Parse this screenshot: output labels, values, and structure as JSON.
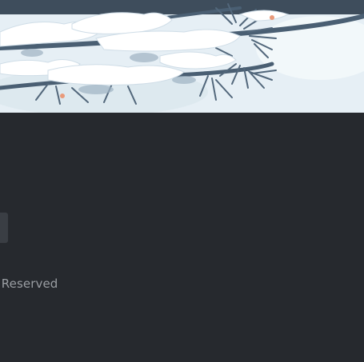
{
  "banner": {
    "image": "snowy-pine-branch-illustration"
  },
  "footer": {
    "button_label": "",
    "copyright_text": "s Reserved"
  },
  "colors": {
    "background": "#26292e",
    "banner_sky": "#e3edf3",
    "branch": "#4a5f73",
    "text_muted": "#9a9ea3",
    "button": "#3a3e44"
  }
}
